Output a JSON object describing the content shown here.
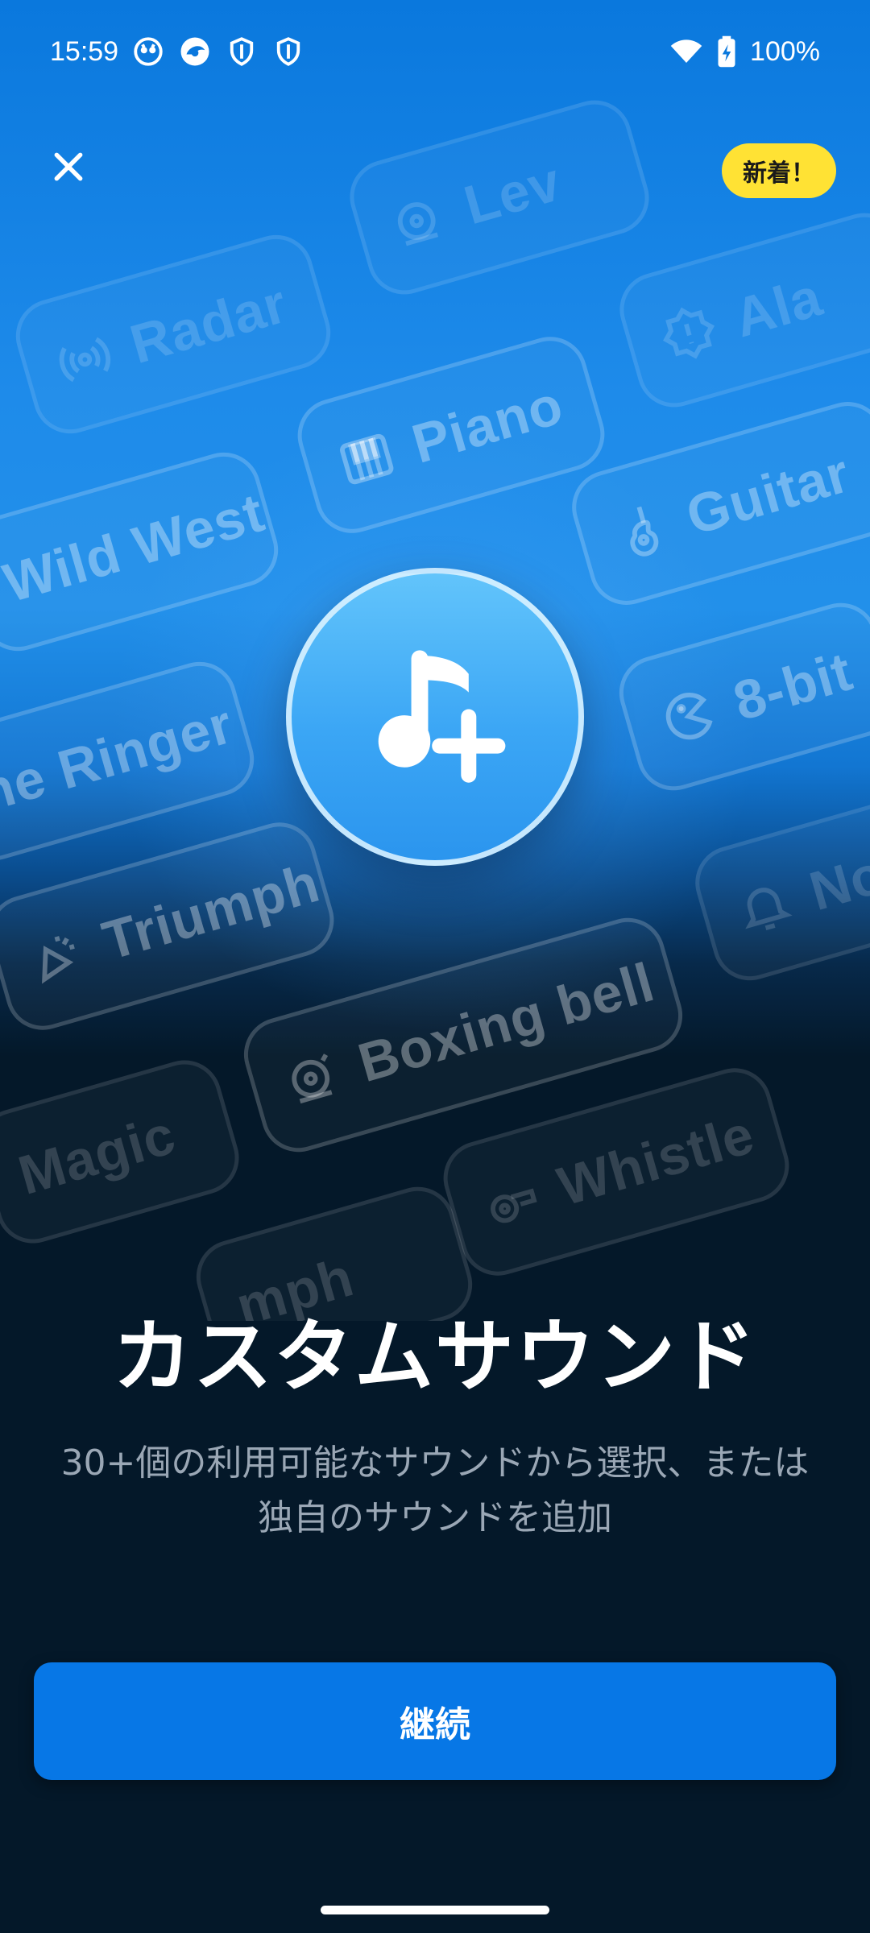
{
  "status_bar": {
    "time": "15:59",
    "battery": "100%",
    "icons": [
      "app-notification-icon",
      "browser-icon",
      "shield-icon",
      "shield-icon",
      "wifi-icon",
      "battery-charging-icon"
    ]
  },
  "header": {
    "close_icon": "close-icon",
    "badge": "新着！"
  },
  "sound_tiles": [
    {
      "label": "Lev",
      "icon": "bell-icon"
    },
    {
      "label": "Radar",
      "icon": "radar-icon"
    },
    {
      "label": "Ala",
      "icon": "alert-badge-icon"
    },
    {
      "label": "Piano",
      "icon": "piano-icon"
    },
    {
      "label": "Wild West",
      "icon": ""
    },
    {
      "label": "Guitar",
      "icon": "guitar-icon"
    },
    {
      "label": "ne Ringer",
      "icon": ""
    },
    {
      "label": "8-bit",
      "icon": "pacman-icon"
    },
    {
      "label": "Triumph",
      "icon": "party-popper-icon"
    },
    {
      "label": "No",
      "icon": "bell-outline-icon"
    },
    {
      "label": "Boxing bell",
      "icon": "boxing-bell-icon"
    },
    {
      "label": "Magic",
      "icon": ""
    },
    {
      "label": "Whistle",
      "icon": "whistle-icon"
    },
    {
      "label": "mph",
      "icon": ""
    }
  ],
  "hero_icon": "music-note-add-icon",
  "main": {
    "title": "カスタムサウンド",
    "subtitle_line1": "30+個の利用可能なサウンドから選択、または",
    "subtitle_line2": "独自のサウンドを追加",
    "continue_label": "継続"
  },
  "colors": {
    "background_top": "#0a78dd",
    "background_bottom": "#041829",
    "accent_button": "#0777e6",
    "badge_yellow": "#ffe234",
    "subtitle_gray": "#9aa7b5"
  }
}
